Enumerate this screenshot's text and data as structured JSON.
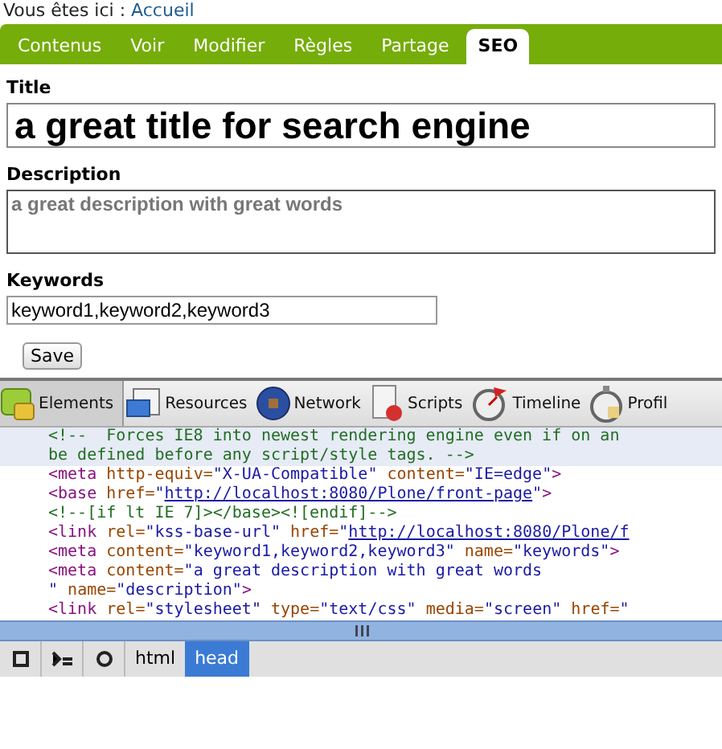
{
  "breadcrumb": {
    "label": "Vous êtes ici :",
    "link": "Accueil"
  },
  "tabs": [
    {
      "label": "Contenus",
      "selected": false
    },
    {
      "label": "Voir",
      "selected": false
    },
    {
      "label": "Modifier",
      "selected": false
    },
    {
      "label": "Règles",
      "selected": false
    },
    {
      "label": "Partage",
      "selected": false
    },
    {
      "label": "SEO",
      "selected": true
    }
  ],
  "form": {
    "title": {
      "label": "Title",
      "value": "a great title for search engine"
    },
    "description": {
      "label": "Description",
      "value": "a great description with great words"
    },
    "keywords": {
      "label": "Keywords",
      "value": "keyword1,keyword2,keyword3"
    },
    "save_button": "Save"
  },
  "devtools": {
    "panels": [
      {
        "label": "Elements",
        "selected": true,
        "kind": "elements"
      },
      {
        "label": "Resources",
        "selected": false,
        "kind": "resources"
      },
      {
        "label": "Network",
        "selected": false,
        "kind": "network"
      },
      {
        "label": "Scripts",
        "selected": false,
        "kind": "scripts"
      },
      {
        "label": "Timeline",
        "selected": false,
        "kind": "timeline"
      },
      {
        "label": "Profil",
        "selected": false,
        "kind": "profiles"
      }
    ],
    "code_lines": [
      {
        "selected": true,
        "segments": [
          {
            "kind": "comment",
            "text": "<!--  Forces IE8 into newest rendering engine even if on an"
          }
        ]
      },
      {
        "selected": true,
        "segments": [
          {
            "kind": "comment",
            "text": "be defined before any script/style tags. -->"
          }
        ]
      },
      {
        "selected": false,
        "segments": [
          {
            "kind": "tag",
            "text": "<meta"
          },
          {
            "kind": "attr",
            "text": " http-equiv="
          },
          {
            "kind": "value",
            "text": "\"X-UA-Compatible\""
          },
          {
            "kind": "attr",
            "text": " content="
          },
          {
            "kind": "value",
            "text": "\"IE=edge\""
          },
          {
            "kind": "tag",
            "text": ">"
          }
        ]
      },
      {
        "selected": false,
        "segments": [
          {
            "kind": "tag",
            "text": "<base"
          },
          {
            "kind": "attr",
            "text": " href="
          },
          {
            "kind": "value",
            "text": "\""
          },
          {
            "kind": "link",
            "text": "http://localhost:8080/Plone/front-page"
          },
          {
            "kind": "value",
            "text": "\""
          },
          {
            "kind": "tag",
            "text": ">"
          }
        ]
      },
      {
        "selected": false,
        "segments": [
          {
            "kind": "comment",
            "text": "<!--[if lt IE 7]></base><![endif]-->"
          }
        ]
      },
      {
        "selected": false,
        "segments": [
          {
            "kind": "tag",
            "text": "<link"
          },
          {
            "kind": "attr",
            "text": " rel="
          },
          {
            "kind": "value",
            "text": "\"kss-base-url\""
          },
          {
            "kind": "attr",
            "text": " href="
          },
          {
            "kind": "value",
            "text": "\""
          },
          {
            "kind": "link",
            "text": "http://localhost:8080/Plone/f"
          }
        ]
      },
      {
        "selected": false,
        "segments": [
          {
            "kind": "tag",
            "text": "<meta"
          },
          {
            "kind": "attr",
            "text": " content="
          },
          {
            "kind": "value",
            "text": "\"keyword1,keyword2,keyword3\""
          },
          {
            "kind": "attr",
            "text": " name="
          },
          {
            "kind": "value",
            "text": "\"keywords\""
          },
          {
            "kind": "tag",
            "text": ">"
          }
        ]
      },
      {
        "selected": false,
        "segments": [
          {
            "kind": "tag",
            "text": "<meta"
          },
          {
            "kind": "attr",
            "text": " content="
          },
          {
            "kind": "value",
            "text": "\"a great description with great words"
          }
        ]
      },
      {
        "selected": false,
        "segments": [
          {
            "kind": "value",
            "text": "\""
          },
          {
            "kind": "attr",
            "text": " name="
          },
          {
            "kind": "value",
            "text": "\"description\""
          },
          {
            "kind": "tag",
            "text": ">"
          }
        ]
      },
      {
        "selected": false,
        "segments": [
          {
            "kind": "tag",
            "text": "<link"
          },
          {
            "kind": "attr",
            "text": " rel="
          },
          {
            "kind": "value",
            "text": "\"stylesheet\""
          },
          {
            "kind": "attr",
            "text": " type="
          },
          {
            "kind": "value",
            "text": "\"text/css\""
          },
          {
            "kind": "attr",
            "text": " media="
          },
          {
            "kind": "value",
            "text": "\"screen\""
          },
          {
            "kind": "attr",
            "text": " href="
          },
          {
            "kind": "value",
            "text": "\""
          }
        ]
      }
    ],
    "crumbs": [
      {
        "label": "html",
        "selected": false
      },
      {
        "label": "head",
        "selected": true
      }
    ]
  }
}
